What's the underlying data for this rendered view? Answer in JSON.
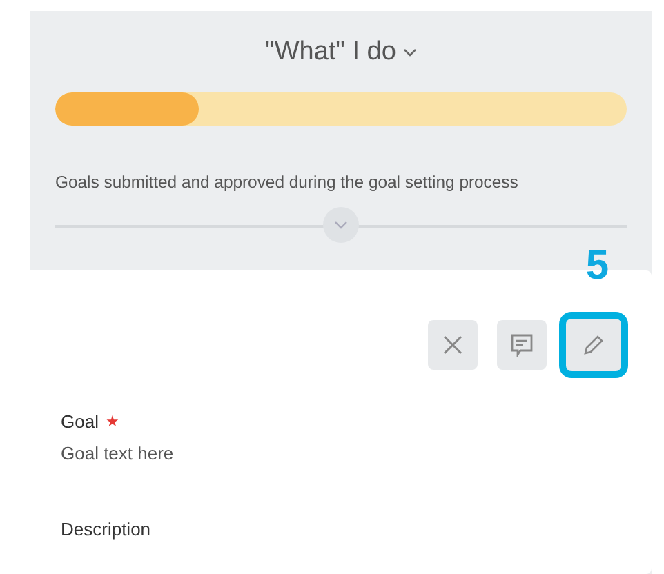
{
  "section": {
    "title": "\"What\" I do",
    "progress": {
      "level": 0.25
    },
    "description": "Goals submitted and approved during the goal setting process"
  },
  "card": {
    "callout": "5",
    "actions": [
      {
        "kind": "remove",
        "highlighted": false
      },
      {
        "kind": "comment",
        "highlighted": false
      },
      {
        "kind": "edit",
        "highlighted": true
      }
    ],
    "fields": [
      {
        "label": "Goal",
        "required_mark": "★",
        "value": "Goal text here"
      },
      {
        "label": "Description"
      }
    ]
  }
}
